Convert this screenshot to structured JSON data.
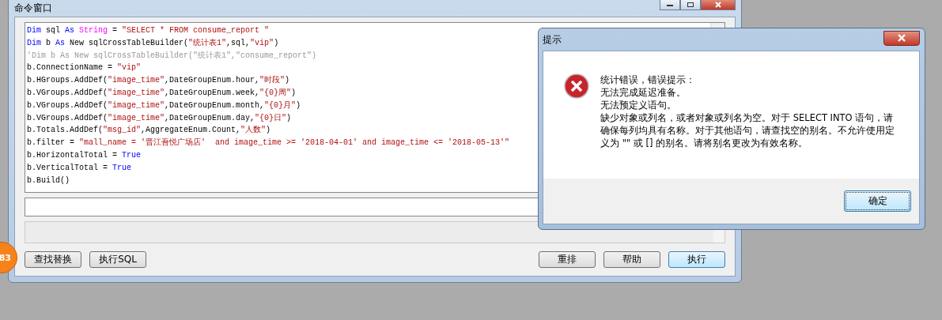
{
  "command_window": {
    "title": "命令窗口",
    "code_lines": [
      [
        {
          "kind": "kw",
          "text": "Dim"
        },
        {
          "kind": "plain",
          "text": " sql "
        },
        {
          "kind": "kw",
          "text": "As "
        },
        {
          "kind": "type",
          "text": "String"
        },
        {
          "kind": "plain",
          "text": " = "
        },
        {
          "kind": "str",
          "text": "\"SELECT * FROM consume_report \""
        }
      ],
      [
        {
          "kind": "kw",
          "text": "Dim"
        },
        {
          "kind": "plain",
          "text": " b "
        },
        {
          "kind": "kw",
          "text": "As"
        },
        {
          "kind": "plain",
          "text": " New sqlCrossTableBuilder("
        },
        {
          "kind": "str",
          "text": "\"统计表1\""
        },
        {
          "kind": "plain",
          "text": ",sql,"
        },
        {
          "kind": "str",
          "text": "\"vip\""
        },
        {
          "kind": "plain",
          "text": ")"
        }
      ],
      [
        {
          "kind": "comment",
          "text": "'Dim b As New sqlCrossTableBuilder(\"统计表1\",\"consume_report\")"
        }
      ],
      [
        {
          "kind": "plain",
          "text": "b.ConnectionName = "
        },
        {
          "kind": "str",
          "text": "\"vip\""
        }
      ],
      [
        {
          "kind": "plain",
          "text": "b.HGroups.AddDef("
        },
        {
          "kind": "str",
          "text": "\"image_time\""
        },
        {
          "kind": "plain",
          "text": ",DateGroupEnum.hour,"
        },
        {
          "kind": "str",
          "text": "\"时段\""
        },
        {
          "kind": "plain",
          "text": ")"
        }
      ],
      [
        {
          "kind": "plain",
          "text": "b.VGroups.AddDef("
        },
        {
          "kind": "str",
          "text": "\"image_time\""
        },
        {
          "kind": "plain",
          "text": ",DateGroupEnum.week,"
        },
        {
          "kind": "str",
          "text": "\"{0}周\""
        },
        {
          "kind": "plain",
          "text": ")"
        }
      ],
      [
        {
          "kind": "plain",
          "text": "b.VGroups.AddDef("
        },
        {
          "kind": "str",
          "text": "\"image_time\""
        },
        {
          "kind": "plain",
          "text": ",DateGroupEnum.month,"
        },
        {
          "kind": "str",
          "text": "\"{0}月\""
        },
        {
          "kind": "plain",
          "text": ")"
        }
      ],
      [
        {
          "kind": "plain",
          "text": "b.VGroups.AddDef("
        },
        {
          "kind": "str",
          "text": "\"image_time\""
        },
        {
          "kind": "plain",
          "text": ",DateGroupEnum.day,"
        },
        {
          "kind": "str",
          "text": "\"{0}日\""
        },
        {
          "kind": "plain",
          "text": ")"
        }
      ],
      [
        {
          "kind": "plain",
          "text": "b.Totals.AddDef("
        },
        {
          "kind": "str",
          "text": "\"msg_id\""
        },
        {
          "kind": "plain",
          "text": ",AggregateEnum.Count,"
        },
        {
          "kind": "str",
          "text": "\"人数\""
        },
        {
          "kind": "plain",
          "text": ")"
        }
      ],
      [
        {
          "kind": "plain",
          "text": "b.filter = "
        },
        {
          "kind": "str",
          "text": "\"mall_name = '晋江吾悦广场店'  and image_time >= '2018-04-01' and image_time <= '2018-05-13'\""
        }
      ],
      [
        {
          "kind": "plain",
          "text": "b.HorizontalTotal = "
        },
        {
          "kind": "kw",
          "text": "True"
        }
      ],
      [
        {
          "kind": "plain",
          "text": "b.VerticalTotal = "
        },
        {
          "kind": "kw",
          "text": "True"
        }
      ],
      [
        {
          "kind": "plain",
          "text": "b.Build()"
        }
      ]
    ],
    "left_buttons": [
      {
        "label": "查找替换",
        "default": false
      },
      {
        "label": "执行SQL",
        "default": false
      }
    ],
    "right_buttons": [
      {
        "label": "重排",
        "default": false
      },
      {
        "label": "帮助",
        "default": false
      },
      {
        "label": "执行",
        "default": true
      }
    ]
  },
  "badge": {
    "text": "83"
  },
  "dialog": {
    "title": "提示",
    "message_lines": [
      "统计错误，错误提示：",
      "无法完成延迟准备。",
      "无法预定义语句。",
      "缺少对象或列名，或者对象或列名为空。对于 SELECT INTO 语句，请确保每列均具有名称。对于其他语句，请查找空的别名。不允许使用定义为 \"\" 或 [] 的别名。请将别名更改为有效名称。"
    ],
    "button": {
      "label": "确定",
      "default": true
    }
  }
}
